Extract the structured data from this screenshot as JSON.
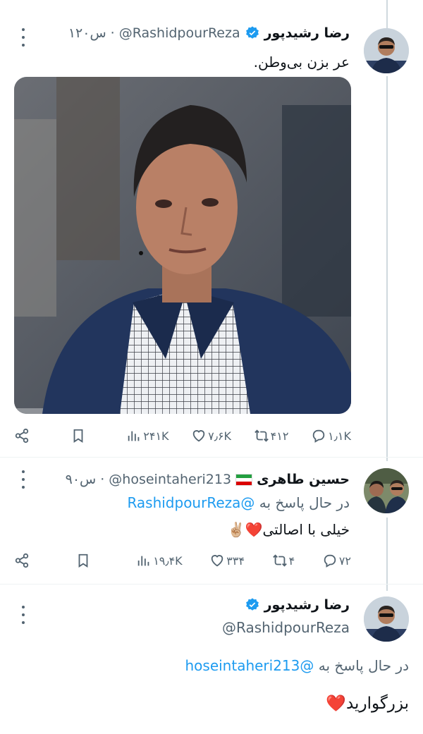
{
  "colors": {
    "accent": "#1d9bf0",
    "text": "#0f1419",
    "muted": "#536471",
    "heart": "#e0245e"
  },
  "tweet1": {
    "name": "رضا رشیدپور",
    "handle": "@RashidpourReza",
    "dot": "·",
    "time": "۱۲۰س",
    "text": "عر بزن بی‌وطن.",
    "actions": {
      "replies": "۱٫۱K",
      "retweets": "۴۱۲",
      "likes": "۷٫۶K",
      "views": "۲۴۱K"
    }
  },
  "tweet2": {
    "name": "حسین طاهری",
    "flag_icon": "iran-flag-icon",
    "handle": "@hoseintaheri213",
    "dot": "·",
    "time": "۹۰س",
    "replying_prefix": "در حال پاسخ به",
    "replying_to": "@RashidpourReza",
    "text": "خیلی با اصالتی",
    "emojis": "❤️✌🏼",
    "actions": {
      "replies": "۷۲",
      "retweets": "۴",
      "likes": "۳۳۴",
      "views": "۱۹٫۴K"
    }
  },
  "tweet3": {
    "name": "رضا رشیدپور",
    "handle": "@RashidpourReza",
    "replying_prefix": "در حال پاسخ به",
    "replying_to": "@hoseintaheri213",
    "text": "بزرگوارید",
    "emoji": "❤️"
  }
}
